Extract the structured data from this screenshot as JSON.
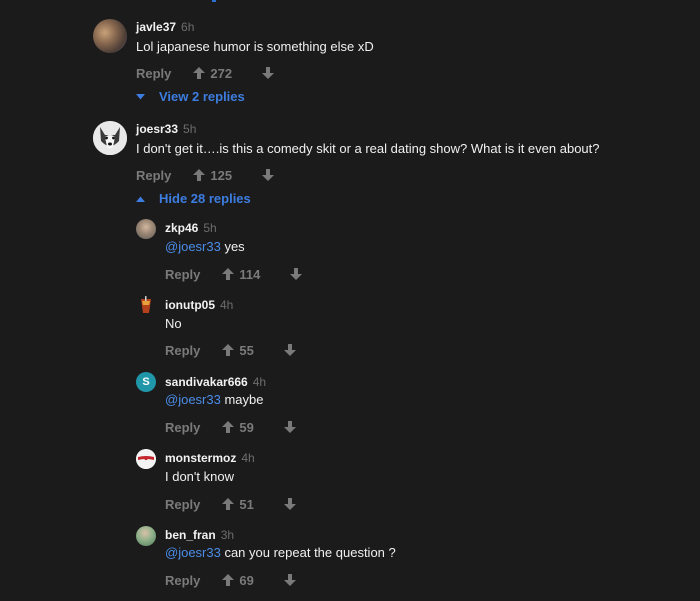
{
  "labels": {
    "reply": "Reply"
  },
  "colors": {
    "background": "#1b1b1b",
    "link": "#3d7de0",
    "mention": "#4b8ce8",
    "muted": "#7a7a7a"
  },
  "comments": [
    {
      "user": "javle37",
      "time": "6h",
      "text": "Lol japanese humor is something else xD",
      "score": "272",
      "avatar": "photo-avatar"
    },
    {
      "user": "joesr33",
      "time": "5h",
      "text": "I don't get it….is this a comedy skit or a real dating show? What is it even about?",
      "score": "125",
      "avatar": "husky-avatar"
    }
  ],
  "toggles": {
    "view_replies": "View 2 replies",
    "hide_replies": "Hide 28 replies"
  },
  "replies": [
    {
      "user": "zkp46",
      "time": "5h",
      "mention": "@joesr33",
      "text": " yes",
      "score": "114",
      "avatar": "photo-avatar"
    },
    {
      "user": "ionutp05",
      "time": "4h",
      "mention": "",
      "text": "No",
      "score": "55",
      "avatar": "drink-avatar"
    },
    {
      "user": "sandivakar666",
      "time": "4h",
      "mention": "@joesr33",
      "text": " maybe",
      "score": "59",
      "avatar": "letter-avatar",
      "avatar_letter": "S"
    },
    {
      "user": "monstermoz",
      "time": "4h",
      "mention": "",
      "text": "I don't know",
      "score": "51",
      "avatar": "ball-avatar"
    },
    {
      "user": "ben_fran",
      "time": "3h",
      "mention": "@joesr33",
      "text": " can you repeat the question ?",
      "score": "69",
      "avatar": "photo-avatar"
    }
  ]
}
